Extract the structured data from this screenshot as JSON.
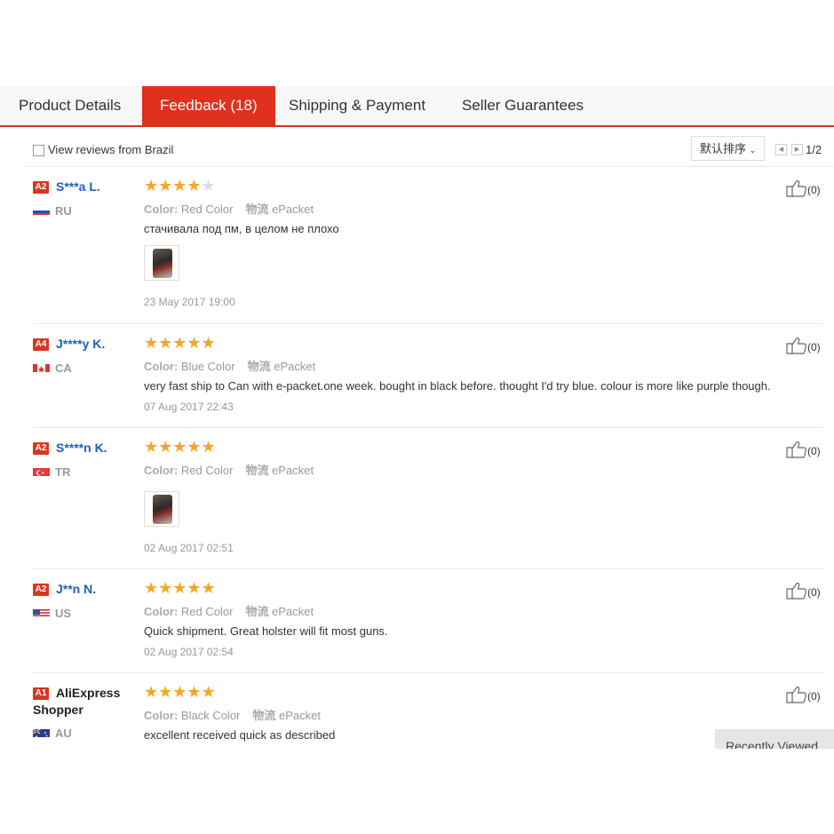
{
  "tabs": [
    {
      "label": "Product Details",
      "active": false
    },
    {
      "label": "Feedback (18)",
      "active": true
    },
    {
      "label": "Shipping & Payment",
      "active": false
    },
    {
      "label": "Seller Guarantees",
      "active": false
    }
  ],
  "filter": {
    "view_brazil_label": "View reviews from Brazil",
    "sort_label": "默认排序",
    "page_indicator": "1/2"
  },
  "reviews": [
    {
      "level": "A2",
      "user": "S***a L.",
      "country": "RU",
      "flag": "ru",
      "rating": 4,
      "color_label": "Color:",
      "color": "Red Color",
      "shipping_label": "物流",
      "shipping": "ePacket",
      "text": "стачивала под пм, в целом не плохо",
      "has_photo": true,
      "date": "23 May 2017 19:00",
      "likes": "(0)"
    },
    {
      "level": "A4",
      "user": "J****y K.",
      "country": "CA",
      "flag": "ca",
      "rating": 5,
      "color_label": "Color:",
      "color": "Blue Color",
      "shipping_label": "物流",
      "shipping": "ePacket",
      "text": "very fast ship to Can with e-packet.one week. bought in black before. thought I'd try blue. colour is more like purple though.",
      "has_photo": false,
      "date": "07 Aug 2017 22:43",
      "likes": "(0)"
    },
    {
      "level": "A2",
      "user": "S****n K.",
      "country": "TR",
      "flag": "tr",
      "rating": 5,
      "color_label": "Color:",
      "color": "Red Color",
      "shipping_label": "物流",
      "shipping": "ePacket",
      "text": "",
      "has_photo": true,
      "date": "02 Aug 2017 02:51",
      "likes": "(0)"
    },
    {
      "level": "A2",
      "user": "J**n N.",
      "country": "US",
      "flag": "us",
      "rating": 5,
      "color_label": "Color:",
      "color": "Red Color",
      "shipping_label": "物流",
      "shipping": "ePacket",
      "text": "Quick shipment. Great holster will fit most guns.",
      "has_photo": false,
      "date": "02 Aug 2017 02:54",
      "likes": "(0)"
    },
    {
      "level": "A1",
      "user_line1": "AliExpress",
      "user_line2": "Shopper",
      "country": "AU",
      "flag": "au",
      "rating": 5,
      "color_label": "Color:",
      "color": "Black Color",
      "shipping_label": "物流",
      "shipping": "ePacket",
      "text": "excellent received quick as described",
      "has_photo": false,
      "date": "",
      "likes": "(0)"
    }
  ],
  "recently_viewed": "Recently Viewed",
  "colors": {
    "accent": "#e0301e",
    "star": "#f5a623",
    "link": "#1f5fb6"
  }
}
